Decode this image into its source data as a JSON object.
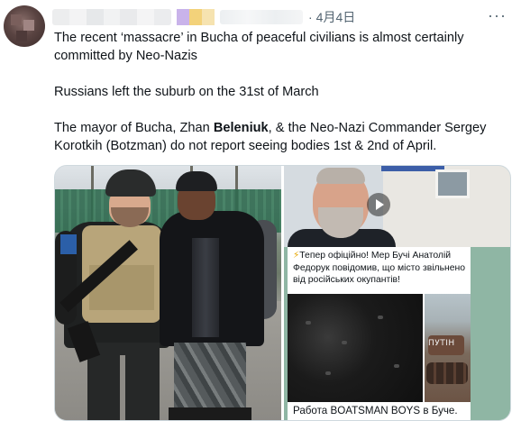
{
  "tweet": {
    "author_avatar_icon": "user-avatar-icon",
    "separator": "·",
    "date": "4月4日",
    "more_label": "···",
    "paragraphs": [
      {
        "id": "p1",
        "text": "The recent ‘massacre’ in Bucha of peaceful civilians is almost certainly committed by Neo-Nazis"
      },
      {
        "id": "p2",
        "text": "Russians left the suburb on the 31st of March"
      }
    ],
    "p3": {
      "before": "The mayor of Bucha, Zhan ",
      "bold": "Beleniuk",
      "after": ", & the Neo-Nazi Commander Sergey Korotkih (Botzman) do not report seeing bodies 1st & 2nd of April."
    }
  },
  "media": {
    "left_image_icon": "soldiers-photo",
    "telegram": {
      "bolt": "⚡",
      "card_text": "Тепер офіційно! Мер Бучі Анатолій Федорук повідомив, що місто звільнено від російських окупантів!",
      "tank_graffiti": "ПУТІН",
      "caption": "Работа BOATSMAN BOYS в Буче."
    }
  },
  "colors": {
    "text": "#0f1419",
    "secondary": "#536471",
    "border": "#cfd9de",
    "telegram_bg": "#8fb6a4"
  }
}
